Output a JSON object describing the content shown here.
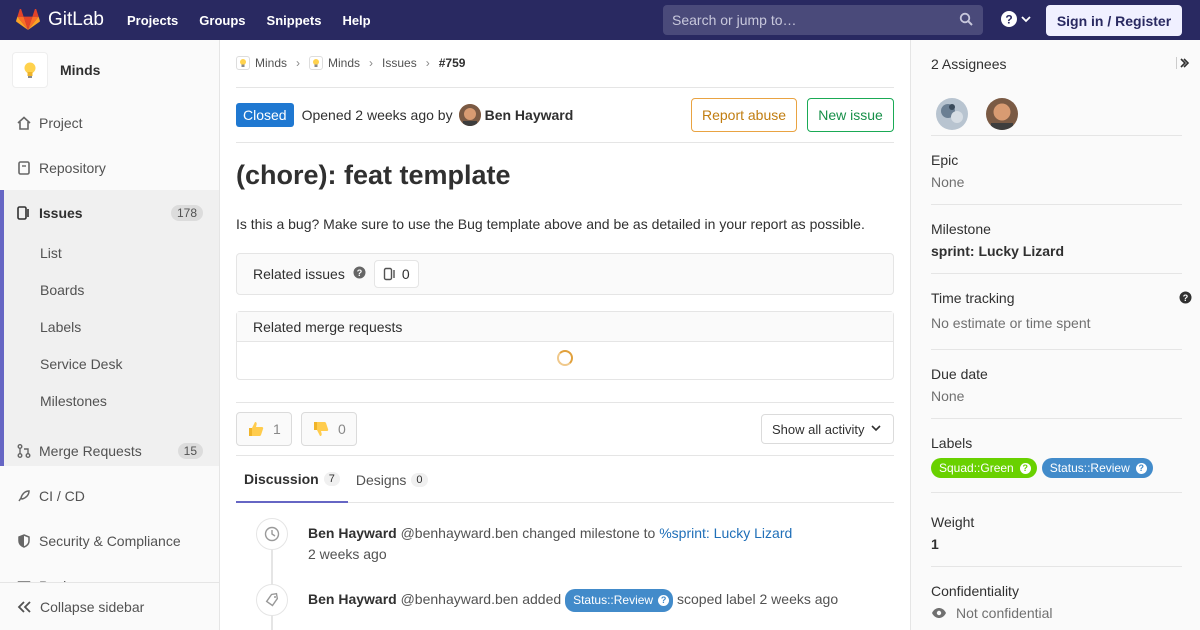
{
  "navbar": {
    "brand": "GitLab",
    "links": [
      "Projects",
      "Groups",
      "Snippets",
      "Help"
    ],
    "search_placeholder": "Search or jump to…",
    "signin": "Sign in / Register"
  },
  "sidebar": {
    "project_name": "Minds",
    "items": {
      "project": "Project",
      "repository": "Repository",
      "issues": "Issues",
      "issues_count": "178",
      "merge_requests": "Merge Requests",
      "mr_count": "15",
      "cicd": "CI / CD",
      "security": "Security & Compliance",
      "packages": "Packages"
    },
    "issue_subitems": [
      "List",
      "Boards",
      "Labels",
      "Service Desk",
      "Milestones"
    ],
    "collapse": "Collapse sidebar"
  },
  "breadcrumb": {
    "group": "Minds",
    "project": "Minds",
    "issues": "Issues",
    "current": "#759"
  },
  "issue": {
    "status": "Closed",
    "opened_text": "Opened 2 weeks ago by",
    "author": "Ben Hayward",
    "report_abuse": "Report abuse",
    "new_issue": "New issue",
    "title": "(chore): feat template",
    "description": "Is this a bug? Make sure to use the Bug template above and be as detailed in your report as possible."
  },
  "related_issues": {
    "label": "Related issues",
    "count": "0"
  },
  "related_mr": {
    "label": "Related merge requests"
  },
  "awards": {
    "thumbs_up": "1",
    "thumbs_down": "0"
  },
  "activity_filter": "Show all activity",
  "tabs": [
    {
      "label": "Discussion",
      "count": "7"
    },
    {
      "label": "Designs",
      "count": "0"
    }
  ],
  "notes": [
    {
      "author": "Ben Hayward",
      "handle": "@benhayward.ben",
      "action": "changed milestone to",
      "link": "%sprint: Lucky Lizard",
      "time": "2 weeks ago"
    },
    {
      "author": "Ben Hayward",
      "handle": "@benhayward.ben",
      "action": "added",
      "label": "Status::Review",
      "suffix": "scoped label 2 weeks ago"
    }
  ],
  "right": {
    "assignees": "2 Assignees",
    "epic_title": "Epic",
    "epic_value": "None",
    "milestone_title": "Milestone",
    "milestone_value": "sprint: Lucky Lizard",
    "time_title": "Time tracking",
    "time_value": "No estimate or time spent",
    "due_title": "Due date",
    "due_value": "None",
    "labels_title": "Labels",
    "labels": [
      {
        "name": "Squad::Green",
        "color": "#69d100"
      },
      {
        "name": "Status::Review",
        "color": "#428bca"
      }
    ],
    "weight_title": "Weight",
    "weight_value": "1",
    "confidentiality_title": "Confidentiality",
    "confidentiality_value": "Not confidential"
  },
  "colors": {
    "navbar": "#292961",
    "accent": "#6666c4",
    "closed": "#1f78d1"
  }
}
